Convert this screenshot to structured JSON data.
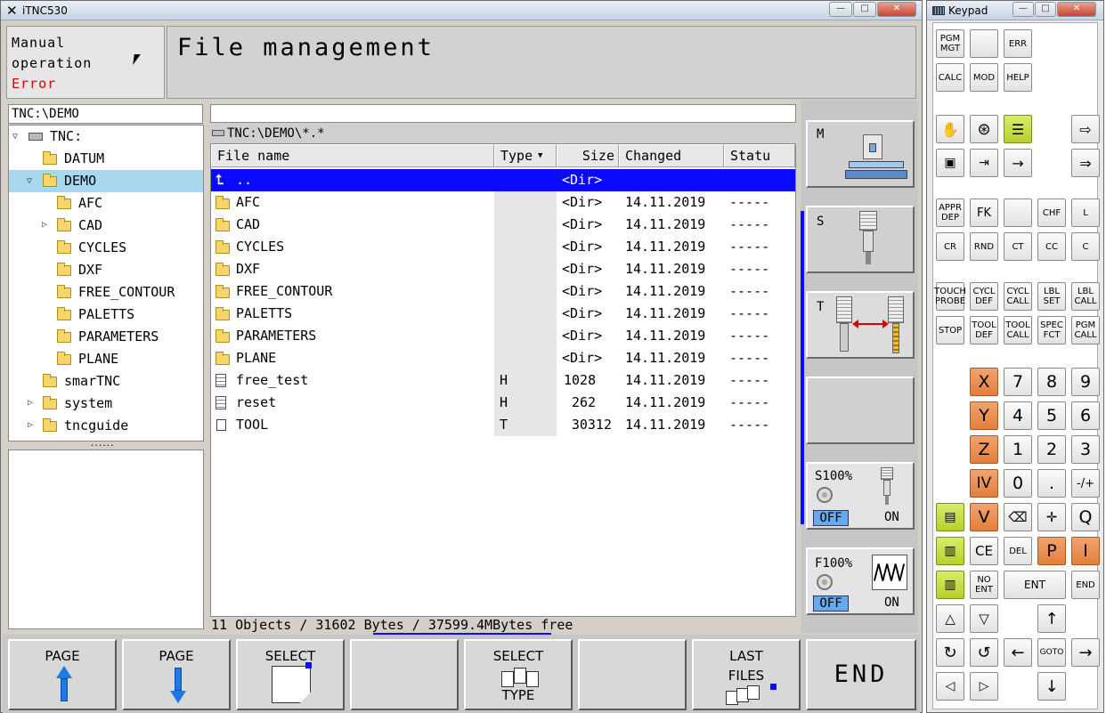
{
  "main_window": {
    "title": "iTNC530",
    "controls": {
      "minimize": "—",
      "maximize": "□",
      "close": "✕"
    }
  },
  "mode": {
    "line1": "Manual",
    "line2": "operation",
    "status": "Error"
  },
  "header": {
    "title": "File management"
  },
  "tree": {
    "path": "TNC:\\DEMO",
    "items": [
      {
        "label": "TNC:"
      },
      {
        "label": "DATUM"
      },
      {
        "label": "DEMO"
      },
      {
        "label": "AFC"
      },
      {
        "label": "CAD"
      },
      {
        "label": "CYCLES"
      },
      {
        "label": "DXF"
      },
      {
        "label": "FREE_CONTOUR"
      },
      {
        "label": "PALETTS"
      },
      {
        "label": "PARAMETERS"
      },
      {
        "label": "PLANE"
      },
      {
        "label": "smarTNC"
      },
      {
        "label": "system"
      },
      {
        "label": "tncguide"
      }
    ],
    "splitter": "......"
  },
  "files": {
    "search_value": "",
    "path": "TNC:\\DEMO\\*.*",
    "columns": {
      "name": "File name",
      "type": "Type",
      "size": "Size",
      "changed": "Changed",
      "status": "Statu"
    },
    "rows": [
      {
        "name": "..",
        "type": "",
        "size": "<Dir>",
        "changed": "",
        "status": ""
      },
      {
        "name": "AFC",
        "type": "",
        "size": "<Dir>",
        "changed": "14.11.2019",
        "status": "-----"
      },
      {
        "name": "CAD",
        "type": "",
        "size": "<Dir>",
        "changed": "14.11.2019",
        "status": "-----"
      },
      {
        "name": "CYCLES",
        "type": "",
        "size": "<Dir>",
        "changed": "14.11.2019",
        "status": "-----"
      },
      {
        "name": "DXF",
        "type": "",
        "size": "<Dir>",
        "changed": "14.11.2019",
        "status": "-----"
      },
      {
        "name": "FREE_CONTOUR",
        "type": "",
        "size": "<Dir>",
        "changed": "14.11.2019",
        "status": "-----"
      },
      {
        "name": "PALETTS",
        "type": "",
        "size": "<Dir>",
        "changed": "14.11.2019",
        "status": "-----"
      },
      {
        "name": "PARAMETERS",
        "type": "",
        "size": "<Dir>",
        "changed": "14.11.2019",
        "status": "-----"
      },
      {
        "name": "PLANE",
        "type": "",
        "size": "<Dir>",
        "changed": "14.11.2019",
        "status": "-----"
      },
      {
        "name": "free_test",
        "type": "H",
        "size": "1028",
        "changed": "14.11.2019",
        "status": "-----"
      },
      {
        "name": "reset",
        "type": "H",
        "size": "262",
        "changed": "14.11.2019",
        "status": "-----"
      },
      {
        "name": "TOOL",
        "type": "T",
        "size": "30312",
        "changed": "14.11.2019",
        "status": "-----"
      }
    ],
    "summary": "11 Objects / 31602 Bytes / 37599.4MBytes free"
  },
  "side": {
    "m_label": "M",
    "s_label": "S",
    "t_label": "T",
    "s_override": "S100%",
    "f_override": "F100%",
    "off": "OFF",
    "on": "ON"
  },
  "softkeys": {
    "page_up": "PAGE",
    "page_down": "PAGE",
    "select": "SELECT",
    "select_type_1": "SELECT",
    "select_type_2": "TYPE",
    "last_files_1": "LAST",
    "last_files_2": "FILES",
    "end": "END"
  },
  "keypad": {
    "title": "Keypad",
    "pgm_mgt": "PGM\nMGT",
    "err": "ERR",
    "calc": "CALC",
    "mod": "MOD",
    "help": "HELP",
    "appr_dep": "APPR\nDEP",
    "fk": "FK",
    "chf": "CHF",
    "l": "L",
    "cr": "CR",
    "rnd": "RND",
    "ct": "CT",
    "cc": "CC",
    "c": "C",
    "touch_probe": "TOUCH\nPROBE",
    "cycl_def": "CYCL\nDEF",
    "cycl_call": "CYCL\nCALL",
    "lbl_set": "LBL\nSET",
    "lbl_call": "LBL\nCALL",
    "stop": "STOP",
    "tool_def": "TOOL\nDEF",
    "tool_call": "TOOL\nCALL",
    "spec_fct": "SPEC\nFCT",
    "pgm_call": "PGM\nCALL",
    "x": "X",
    "y": "Y",
    "z": "Z",
    "iv": "IV",
    "v": "V",
    "n7": "7",
    "n8": "8",
    "n9": "9",
    "n4": "4",
    "n5": "5",
    "n6": "6",
    "n1": "1",
    "n2": "2",
    "n3": "3",
    "n0": "0",
    "dot": ".",
    "pm": "-/+",
    "q": "Q",
    "ce": "CE",
    "del": "DEL",
    "p": "P",
    "i": "I",
    "no_ent": "NO\nENT",
    "ent": "ENT",
    "end": "END",
    "goto": "GOTO"
  },
  "colors": {
    "accent_blue": "#0a0aff",
    "error_red": "#e00000",
    "orange_key": "#e17f3c",
    "lime_key": "#b8d02a"
  }
}
